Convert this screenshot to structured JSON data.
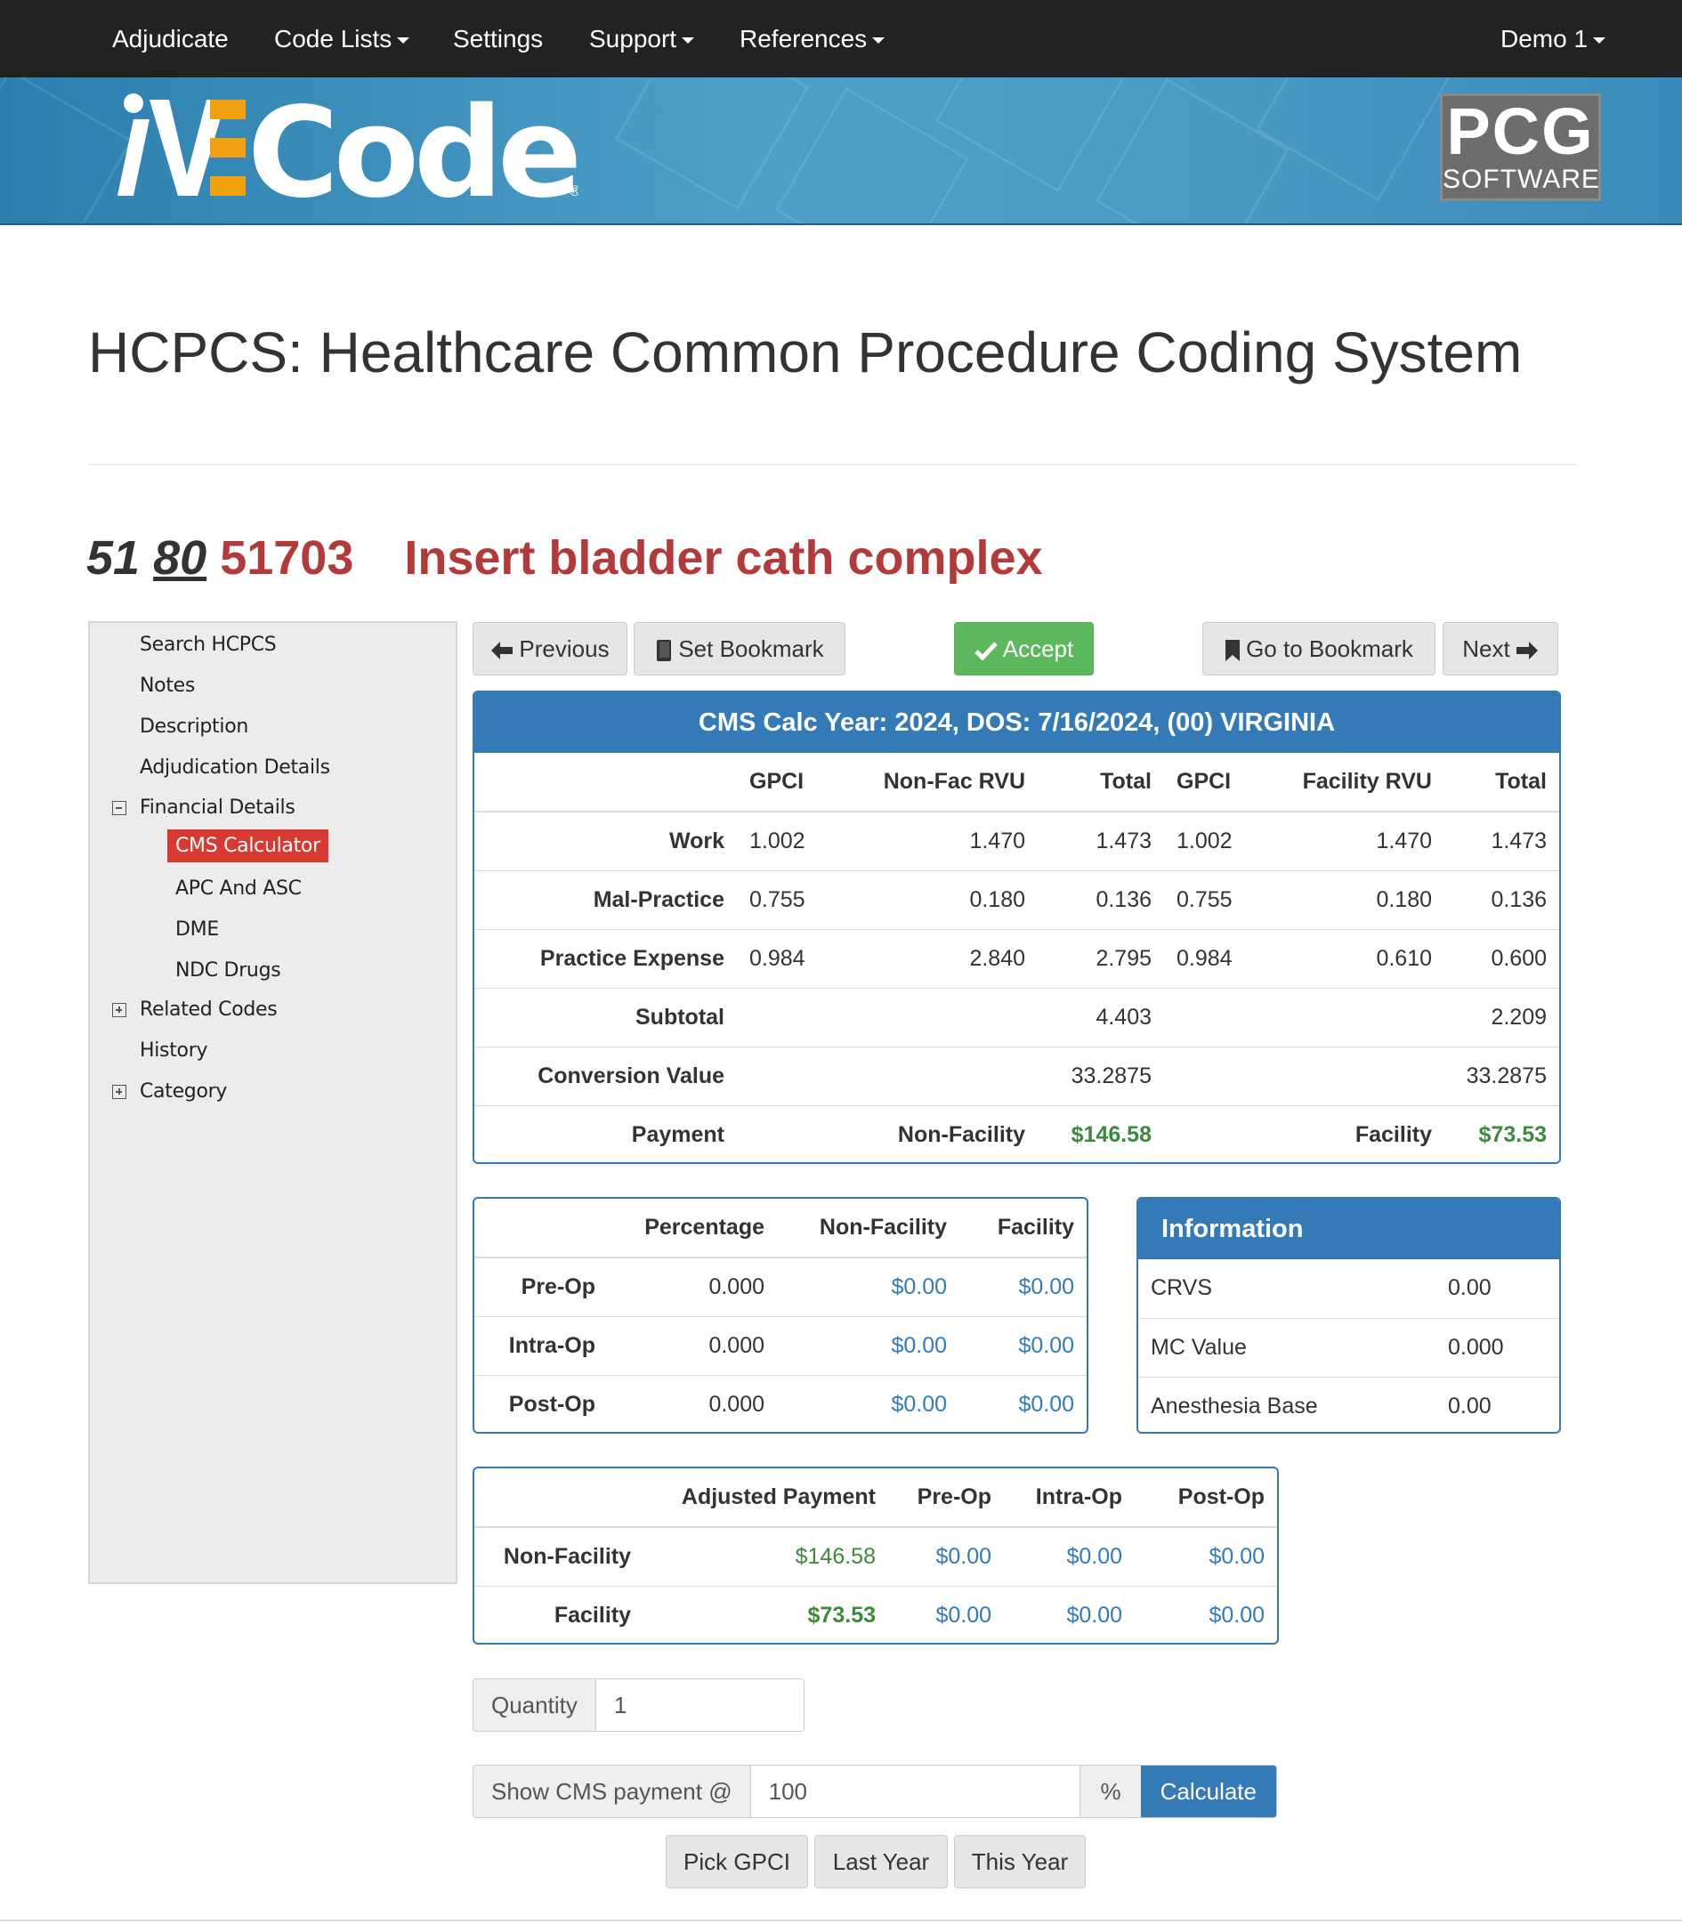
{
  "nav": {
    "adjudicate": "Adjudicate",
    "code_lists": "Code Lists",
    "settings": "Settings",
    "support": "Support",
    "references": "References",
    "user": "Demo 1"
  },
  "banner": {
    "logo_text": "iVECoder",
    "vendor_top": "PCG",
    "vendor_bottom": "SOFTWARE"
  },
  "page": {
    "title": "HCPCS: Healthcare Common Procedure Coding System",
    "code_part1": "51",
    "code_part2": "80",
    "code": "51703",
    "description": "Insert bladder cath complex"
  },
  "sidebar": {
    "search": "Search HCPCS",
    "notes": "Notes",
    "description": "Description",
    "adjudication": "Adjudication Details",
    "financial": "Financial Details",
    "cms_calc": "CMS Calculator",
    "apc": "APC And ASC",
    "dme": "DME",
    "ndc": "NDC Drugs",
    "related": "Related Codes",
    "history": "History",
    "category": "Category"
  },
  "toolbar": {
    "previous": "Previous",
    "set_bookmark": "Set Bookmark",
    "accept": "Accept",
    "go_bookmark": "Go to Bookmark",
    "next": "Next"
  },
  "cms": {
    "heading": "CMS Calc Year: 2024, DOS: 7/16/2024, (00) VIRGINIA",
    "headers": [
      "GPCI",
      "Non-Fac RVU",
      "Total",
      "GPCI",
      "Facility RVU",
      "Total"
    ],
    "rows": [
      {
        "label": "Work",
        "v": [
          "1.002",
          "1.470",
          "1.473",
          "1.002",
          "1.470",
          "1.473"
        ]
      },
      {
        "label": "Mal-Practice",
        "v": [
          "0.755",
          "0.180",
          "0.136",
          "0.755",
          "0.180",
          "0.136"
        ]
      },
      {
        "label": "Practice Expense",
        "v": [
          "0.984",
          "2.840",
          "2.795",
          "0.984",
          "0.610",
          "0.600"
        ]
      }
    ],
    "subtotal_label": "Subtotal",
    "subtotal_nonfac": "4.403",
    "subtotal_fac": "2.209",
    "conversion_label": "Conversion Value",
    "conversion_nonfac": "33.2875",
    "conversion_fac": "33.2875",
    "payment_label": "Payment",
    "nonfac_label": "Non-Facility",
    "nonfac_payment": "$146.58",
    "fac_label": "Facility",
    "fac_payment": "$73.53"
  },
  "periop": {
    "headers": [
      "Percentage",
      "Non-Facility",
      "Facility"
    ],
    "rows": [
      {
        "label": "Pre-Op",
        "pct": "0.000",
        "nonfac": "$0.00",
        "fac": "$0.00"
      },
      {
        "label": "Intra-Op",
        "pct": "0.000",
        "nonfac": "$0.00",
        "fac": "$0.00"
      },
      {
        "label": "Post-Op",
        "pct": "0.000",
        "nonfac": "$0.00",
        "fac": "$0.00"
      }
    ]
  },
  "info": {
    "heading": "Information",
    "rows": [
      {
        "label": "CRVS",
        "value": "0.00"
      },
      {
        "label": "MC Value",
        "value": "0.000"
      },
      {
        "label": "Anesthesia Base",
        "value": "0.00"
      }
    ]
  },
  "adjusted": {
    "headers": [
      "Adjusted Payment",
      "Pre-Op",
      "Intra-Op",
      "Post-Op"
    ],
    "rows": [
      {
        "label": "Non-Facility",
        "payment": "$146.58",
        "pre": "$0.00",
        "intra": "$0.00",
        "post": "$0.00"
      },
      {
        "label": "Facility",
        "payment": "$73.53",
        "pre": "$0.00",
        "intra": "$0.00",
        "post": "$0.00"
      }
    ]
  },
  "form": {
    "quantity_label": "Quantity",
    "quantity_value": "1",
    "show_cms_label": "Show CMS payment @",
    "percent_value": "100",
    "percent_sign": "%",
    "calculate": "Calculate",
    "pick_gpci": "Pick GPCI",
    "last_year": "Last Year",
    "this_year": "This Year"
  },
  "colors": {
    "nav_bg": "#222222",
    "banner_blue": "#3a8abb",
    "accent_red": "#b33a3a",
    "primary": "#337ab7",
    "success": "#5cb85c",
    "money_green": "#3c8a3c"
  }
}
